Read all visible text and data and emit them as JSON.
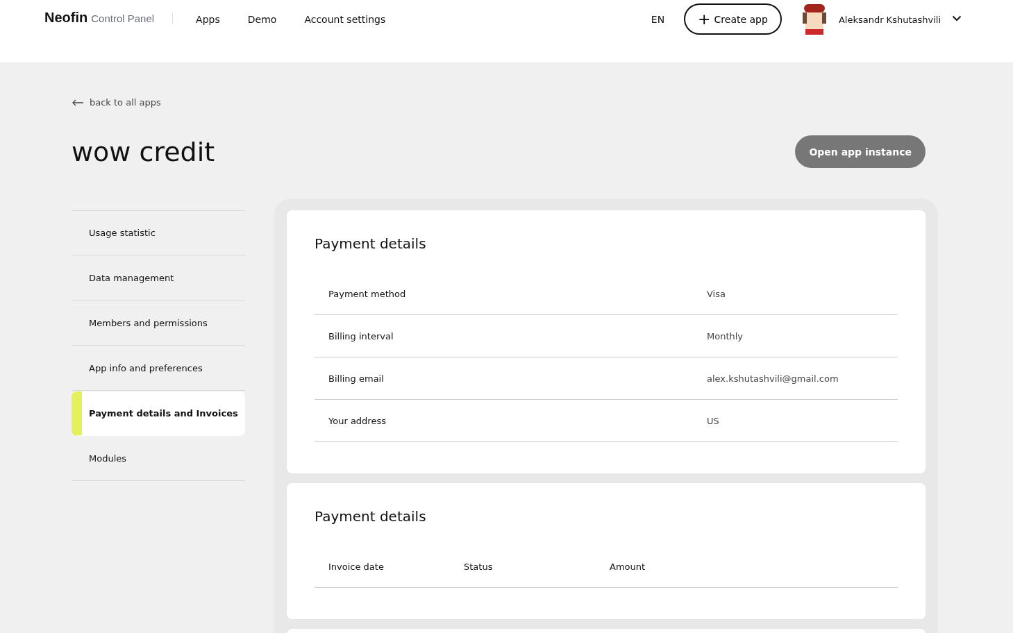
{
  "header": {
    "brand": "Neofin",
    "brand_sub": "Control Panel",
    "nav": [
      {
        "label": "Apps"
      },
      {
        "label": "Demo"
      },
      {
        "label": "Account settings"
      }
    ],
    "language": "EN",
    "create_button": {
      "icon": "+",
      "label": "Create app"
    },
    "user": {
      "name": "Aleksandr Kshutashvili"
    }
  },
  "back_link": "back to all apps",
  "title": "wow credit",
  "open_button": "Open app instance",
  "sidebar": {
    "items": [
      {
        "label": "Usage statistic",
        "selected": false
      },
      {
        "label": "Data management",
        "selected": false
      },
      {
        "label": "Members and permissions",
        "selected": false
      },
      {
        "label": "App info and preferences",
        "selected": false
      },
      {
        "label": "Payment details and Invoices",
        "selected": true
      },
      {
        "label": "Modules",
        "selected": false
      }
    ]
  },
  "payment_card": {
    "title": "Payment details",
    "rows": [
      {
        "label": "Payment method",
        "value": "Visa"
      },
      {
        "label": "Billing interval",
        "value": "Monthly"
      },
      {
        "label": "Billing email",
        "value": "alex.kshutashvili@gmail.com"
      },
      {
        "label": "Your address",
        "value": "US"
      }
    ]
  },
  "invoices_card": {
    "title": "Payment details",
    "columns": [
      "Invoice date",
      "Status",
      "Amount"
    ]
  }
}
